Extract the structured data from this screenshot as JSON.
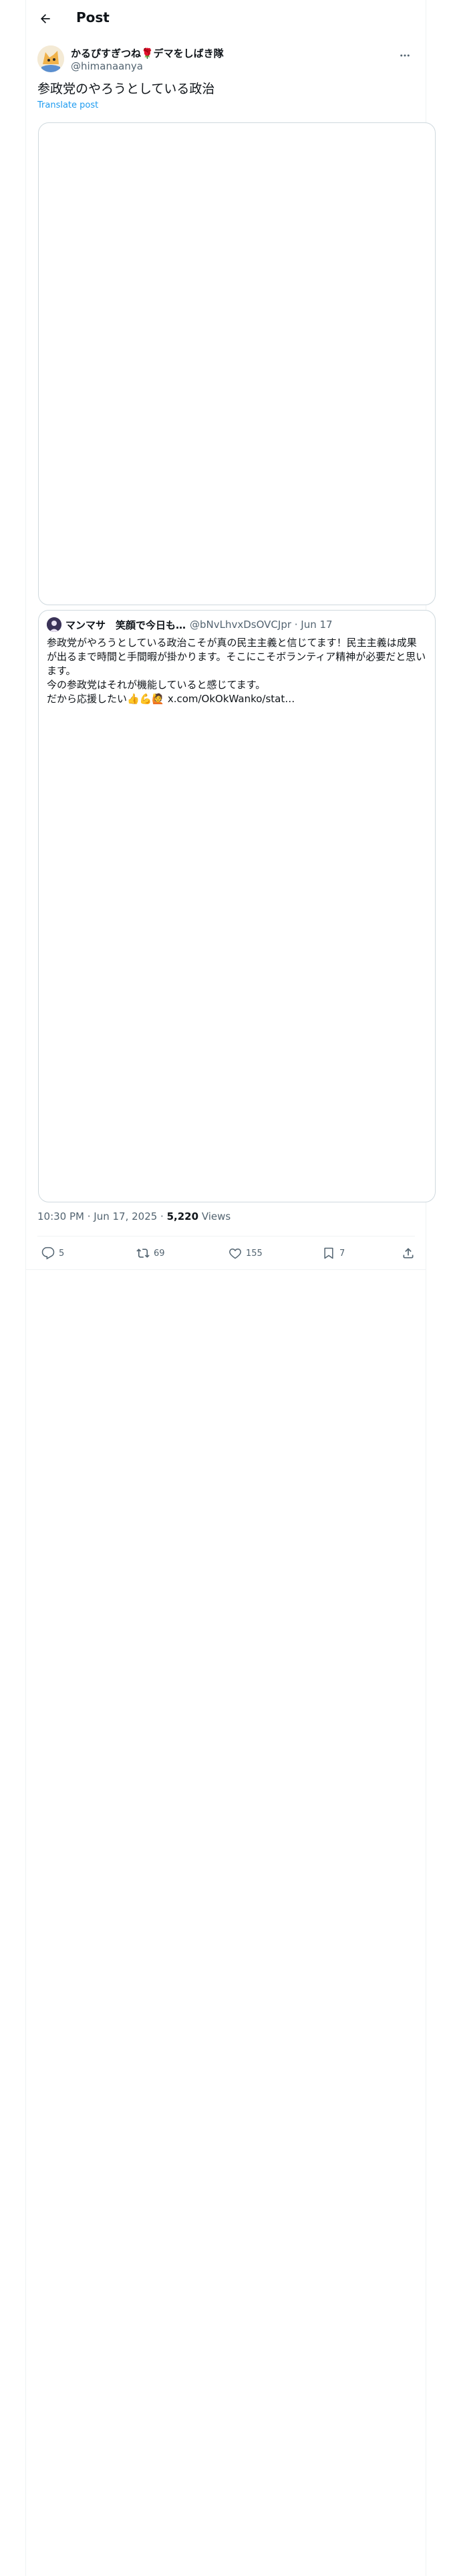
{
  "header": {
    "title": "Post",
    "back_icon": "arrow-left-icon"
  },
  "author": {
    "name": "かるぴすぎつね🌹デマをしばき隊",
    "handle": "@himanaanya",
    "more_icon": "more-horizontal-icon"
  },
  "post": {
    "text": "参政党のやろうとしている政治",
    "translate": "Translate post"
  },
  "quote": {
    "name": "マンマサ　笑顔で今日も…",
    "handle": "@bNvLhvxDsOVCJpr · Jun 17",
    "text": "参政党がやろうとしている政治こそが真の民主主義と信じてます！民主主義は成果が出るまで時間と手間暇が掛かります。そこにこそボランティア精神が必要だと思います。\n今の参政党はそれが機能していると感じてます。\nだから応援したい👍💪🙋 ",
    "link": "x.com/OkOkWanko/stat…"
  },
  "meta": {
    "time": "10:30 PM · Jun 17, 2025 · ",
    "views_count": "5,220",
    "views_label": " Views"
  },
  "actions": {
    "replies": "5",
    "reposts": "69",
    "likes": "155",
    "bookmarks": "7"
  },
  "colors": {
    "link": "#1d9bf0",
    "secondary": "#536471",
    "border": "#cfd9de"
  }
}
